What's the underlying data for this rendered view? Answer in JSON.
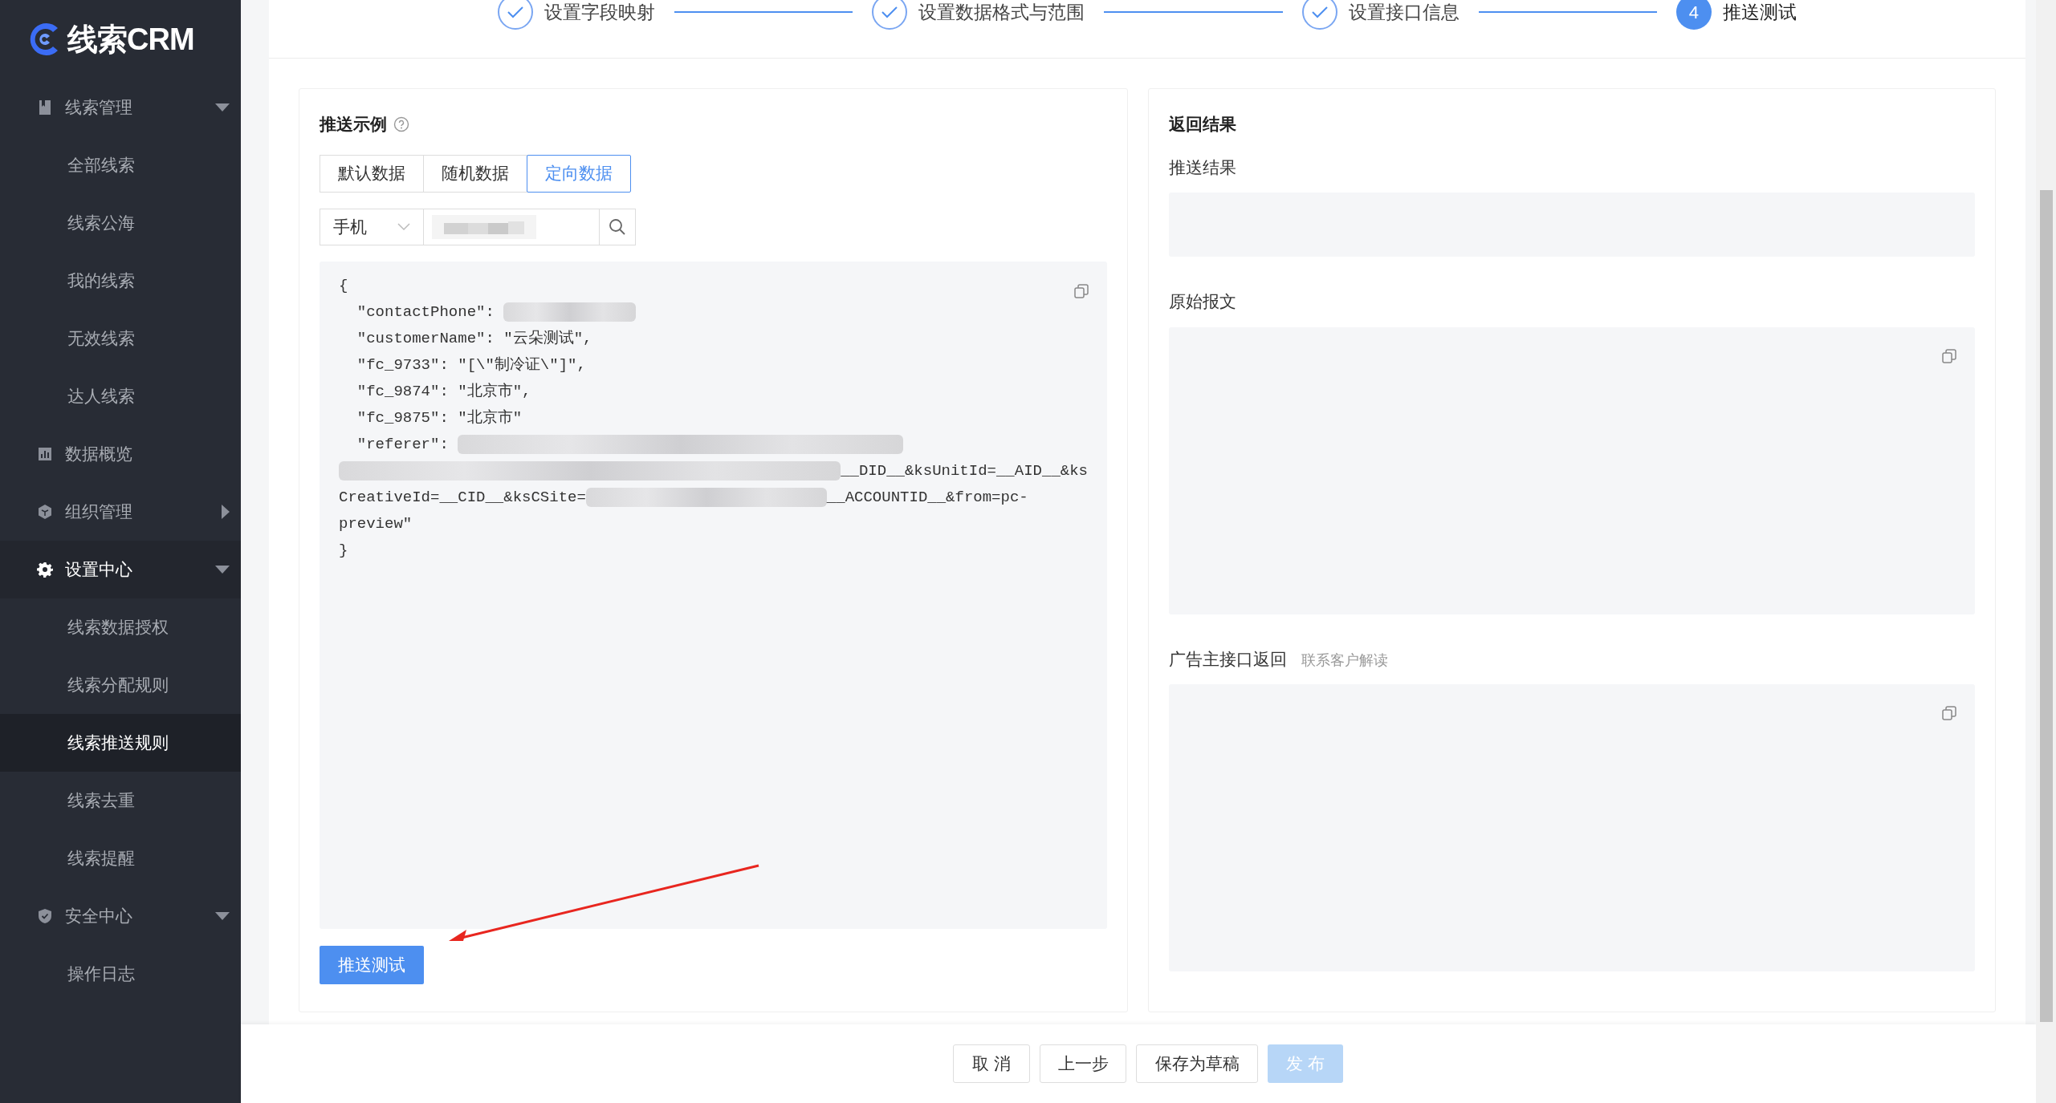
{
  "logo": {
    "text": "线索CRM"
  },
  "sidebar": {
    "items": [
      {
        "kind": "group",
        "label": "线索管理",
        "expanded": true,
        "selected": false,
        "children": [
          {
            "label": "全部线索",
            "selected": false
          },
          {
            "label": "线索公海",
            "selected": false
          },
          {
            "label": "我的线索",
            "selected": false
          },
          {
            "label": "无效线索",
            "selected": false
          },
          {
            "label": "达人线索",
            "selected": false
          }
        ]
      },
      {
        "kind": "link",
        "label": "数据概览",
        "selected": false
      },
      {
        "kind": "group",
        "label": "组织管理",
        "expanded": false,
        "selected": false
      },
      {
        "kind": "group",
        "label": "设置中心",
        "expanded": true,
        "selected": true,
        "children": [
          {
            "label": "线索数据授权",
            "selected": false
          },
          {
            "label": "线索分配规则",
            "selected": false
          },
          {
            "label": "线索推送规则",
            "selected": true
          },
          {
            "label": "线索去重",
            "selected": false
          },
          {
            "label": "线索提醒",
            "selected": false
          }
        ]
      },
      {
        "kind": "group",
        "label": "安全中心",
        "expanded": true,
        "selected": false,
        "children": [
          {
            "label": "操作日志",
            "selected": false
          }
        ]
      }
    ]
  },
  "steps": [
    {
      "label": "设置字段映射",
      "done": true
    },
    {
      "label": "设置数据格式与范围",
      "done": true
    },
    {
      "label": "设置接口信息",
      "done": true
    },
    {
      "label": "推送测试",
      "done": false,
      "number": "4"
    }
  ],
  "example": {
    "title": "推送示例",
    "tabs": [
      {
        "label": "默认数据",
        "selected": false
      },
      {
        "label": "随机数据",
        "selected": false
      },
      {
        "label": "定向数据",
        "selected": true
      }
    ],
    "search": {
      "type": "手机"
    },
    "code_lines": [
      {
        "parts": [
          {
            "kind": "text",
            "text": "{"
          }
        ]
      },
      {
        "parts": [
          {
            "kind": "text",
            "text": "  \"contactPhone\": "
          },
          {
            "kind": "blurshort"
          }
        ]
      },
      {
        "parts": [
          {
            "kind": "text",
            "text": "  \"customerName\": \"云朵测试\","
          }
        ]
      },
      {
        "parts": [
          {
            "kind": "text",
            "text": "  \"fc_9733\": \"[\\\"制冷证\\\"]\","
          }
        ]
      },
      {
        "parts": [
          {
            "kind": "text",
            "text": "  \"fc_9874\": \"北京市\","
          }
        ]
      },
      {
        "parts": [
          {
            "kind": "text",
            "text": "  \"fc_9875\": \"北京市\""
          }
        ]
      },
      {
        "parts": [
          {
            "kind": "text",
            "text": "  \"referer\": "
          },
          {
            "kind": "blurlong"
          }
        ]
      },
      {
        "parts": [
          {
            "kind": "blurfull"
          },
          {
            "kind": "text",
            "text": "__DID__&ksUnitId=__AID__&ks"
          }
        ]
      },
      {
        "parts": [
          {
            "kind": "text",
            "text": "CreativeId=__CID__&ksCSite="
          },
          {
            "kind": "blurmid"
          },
          {
            "kind": "text",
            "text": "__ACCOUNTID__&from=pc-"
          }
        ]
      },
      {
        "parts": [
          {
            "kind": "text",
            "text": "preview\""
          }
        ]
      },
      {
        "parts": [
          {
            "kind": "text",
            "text": "}"
          }
        ]
      }
    ],
    "button": "推送测试"
  },
  "result": {
    "title": "返回结果",
    "sections": [
      {
        "label": "推送结果",
        "copy": false
      },
      {
        "label": "原始报文",
        "copy": true
      },
      {
        "label": "广告主接口返回",
        "link": "联系客户解读",
        "copy": true
      }
    ]
  },
  "footer": {
    "buttons": [
      {
        "label": "取 消",
        "disabled": false,
        "primary": false
      },
      {
        "label": "上一步",
        "disabled": false,
        "primary": false
      },
      {
        "label": "保存为草稿",
        "disabled": false,
        "primary": false
      },
      {
        "label": "发 布",
        "disabled": true,
        "primary": true
      }
    ]
  }
}
